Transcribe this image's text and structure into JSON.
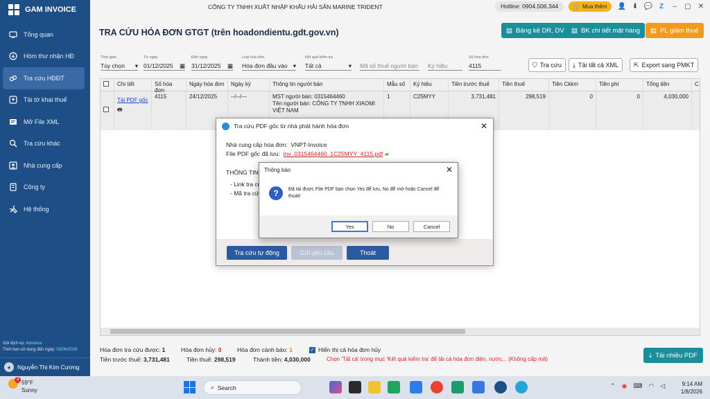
{
  "app": {
    "name": "GAM INVOICE",
    "company": "CÔNG TY TNHH XUẤT NHẬP KHẨU HẢI SẢN MARINE TRIDENT",
    "hotline": "Hotline: 0904.506.344",
    "buy_label": "Mua thêm"
  },
  "sidebar": {
    "items": [
      {
        "label": "Tổng quan",
        "icon": "monitor-icon"
      },
      {
        "label": "Hòm thư nhận HĐ",
        "icon": "inbox-icon"
      },
      {
        "label": "Tra cứu HĐĐT",
        "icon": "link-icon"
      },
      {
        "label": "Tải tờ khai thuế",
        "icon": "upload-icon"
      },
      {
        "label": "Mở File XML",
        "icon": "xml-icon"
      },
      {
        "label": "Tra cứu khác",
        "icon": "search-icon"
      },
      {
        "label": "Nhà cung cấp",
        "icon": "contact-icon"
      },
      {
        "label": "Công ty",
        "icon": "building-icon"
      },
      {
        "label": "Hệ thống",
        "icon": "tools-icon"
      }
    ],
    "active_index": 2,
    "service_label": "Gói dịch vụ:",
    "service_value": "Advance",
    "expiry_label": "Thời hạn sử dụng đến ngày:",
    "expiry_value": "03/06/2029",
    "user_name": "Nguyễn Thị Kim Cương"
  },
  "header": {
    "title": "TRA CỨU HÓA ĐƠN GTGT (trên hoadondientu.gdt.gov.vn)",
    "btn_bang_ke": "Bảng kê DR, DV",
    "btn_bk_chi_tiet": "BK chi tiết mặt hàng",
    "btn_pl_giam_thue": "PL giảm thuế"
  },
  "filters": {
    "thoi_gian_label": "Thời gian",
    "thoi_gian": "Tùy chọn",
    "tu_ngay_label": "Từ ngày",
    "tu_ngay": "01/12/2025",
    "den_ngay_label": "Đến ngày",
    "den_ngay": "31/12/2025",
    "loai_label": "Loại hóa đơn",
    "loai": "Hóa đơn đầu vào",
    "ket_qua_label": "Kết quả kiểm tra",
    "ket_qua": "Tất cả",
    "mst_placeholder": "Mã số thuế người bán",
    "ky_hieu_placeholder": "Ký hiệu",
    "so_hd_label": "Số hóa đơn",
    "so_hd": "4115",
    "btn_tra_cuu": "Tra cứu",
    "btn_tai_xml": "Tải tất cả XML",
    "btn_export": "Export sang PMKT"
  },
  "table": {
    "headers": [
      "",
      "Chi tiết",
      "Số hóa đơn",
      "Ngày hóa đơn",
      "Ngày ký",
      "Thông tin người bán",
      "Mẫu số",
      "Ký hiệu",
      "Tiền trước thuế",
      "Tiền thuế",
      "Tiền Ckkm",
      "Tiền phí",
      "Tổng tiền",
      "C"
    ],
    "row": {
      "chi_tiet": "Tải PDF gốc",
      "so_hd": "4115",
      "ngay_hd": "24/12/2025",
      "ngay_ky": "--/--/---",
      "nguoi_ban_line1": "MST người bán: 0315464460",
      "nguoi_ban_line2": "Tên người bán: CÔNG TY TNHH XIAOMI VIỆT NAM",
      "mau_so": "1",
      "ky_hieu": "C25MYY",
      "tien_truoc_thue": "3,731,481",
      "tien_thue": "298,519",
      "tien_ckkm": "0",
      "tien_phi": "0",
      "tong_tien": "4,030,000"
    }
  },
  "summary": {
    "tra_cuu_label": "Hóa đơn tra cứu được:",
    "tra_cuu": "1",
    "huy_label": "Hóa đơn hủy:",
    "huy": "0",
    "canh_bao_label": "Hóa đơn cảnh báo:",
    "canh_bao": "1",
    "hien_thi_label": "Hiển thị cả hóa đơn hủy",
    "truoc_thue_label": "Tiền trước thuế:",
    "truoc_thue": "3,731,481",
    "thue_label": "Tiền thuế:",
    "thue": "298,519",
    "thanh_tien_label": "Thành tiền:",
    "thanh_tien": "4,030,000",
    "note": "Chọn 'Tất cả' trong mục 'Kết quả kiểm tra' để tải cả hóa đơn điện, nước,.. (Không cấp mã)",
    "btn_tai_nhieu_pdf": "Tải nhiều PDF"
  },
  "pdf_dialog": {
    "title": "Tra cứu PDF gốc từ nhà phát hành hóa đơn",
    "provider_label": "Nhà cung cấp hóa đơn:",
    "provider": "VNPT-Invoice",
    "file_label": "File PDF gốc đã lưu:",
    "file_name": "inv_0315464460_1C25MYY_4115.pdf",
    "info_heading": "THÔNG TIN",
    "link_line": "- Link tra cứ",
    "code_line": "- Mã tra cứ",
    "btn_tra_cuu": "Tra cứu tự động",
    "btn_gui": "Gửi yêu cầu",
    "btn_thoat": "Thoát"
  },
  "message_box": {
    "title": "Thông báo",
    "text": "Đã tải được File PDF bạn chọn Yes để lưu, No để mở hoặc Cancel để thoát!",
    "yes": "Yes",
    "no": "No",
    "cancel": "Cancel"
  },
  "taskbar": {
    "temp": "59°F",
    "weather": "Sunny",
    "weather_badge": "3",
    "search": "Search",
    "time": "9:14 AM",
    "date": "1/8/2026"
  },
  "colors": {
    "sidebar": "#1e4e86",
    "teal_button": "#1b8e9c",
    "orange_button": "#f29a1b",
    "link_red": "#d32020"
  }
}
